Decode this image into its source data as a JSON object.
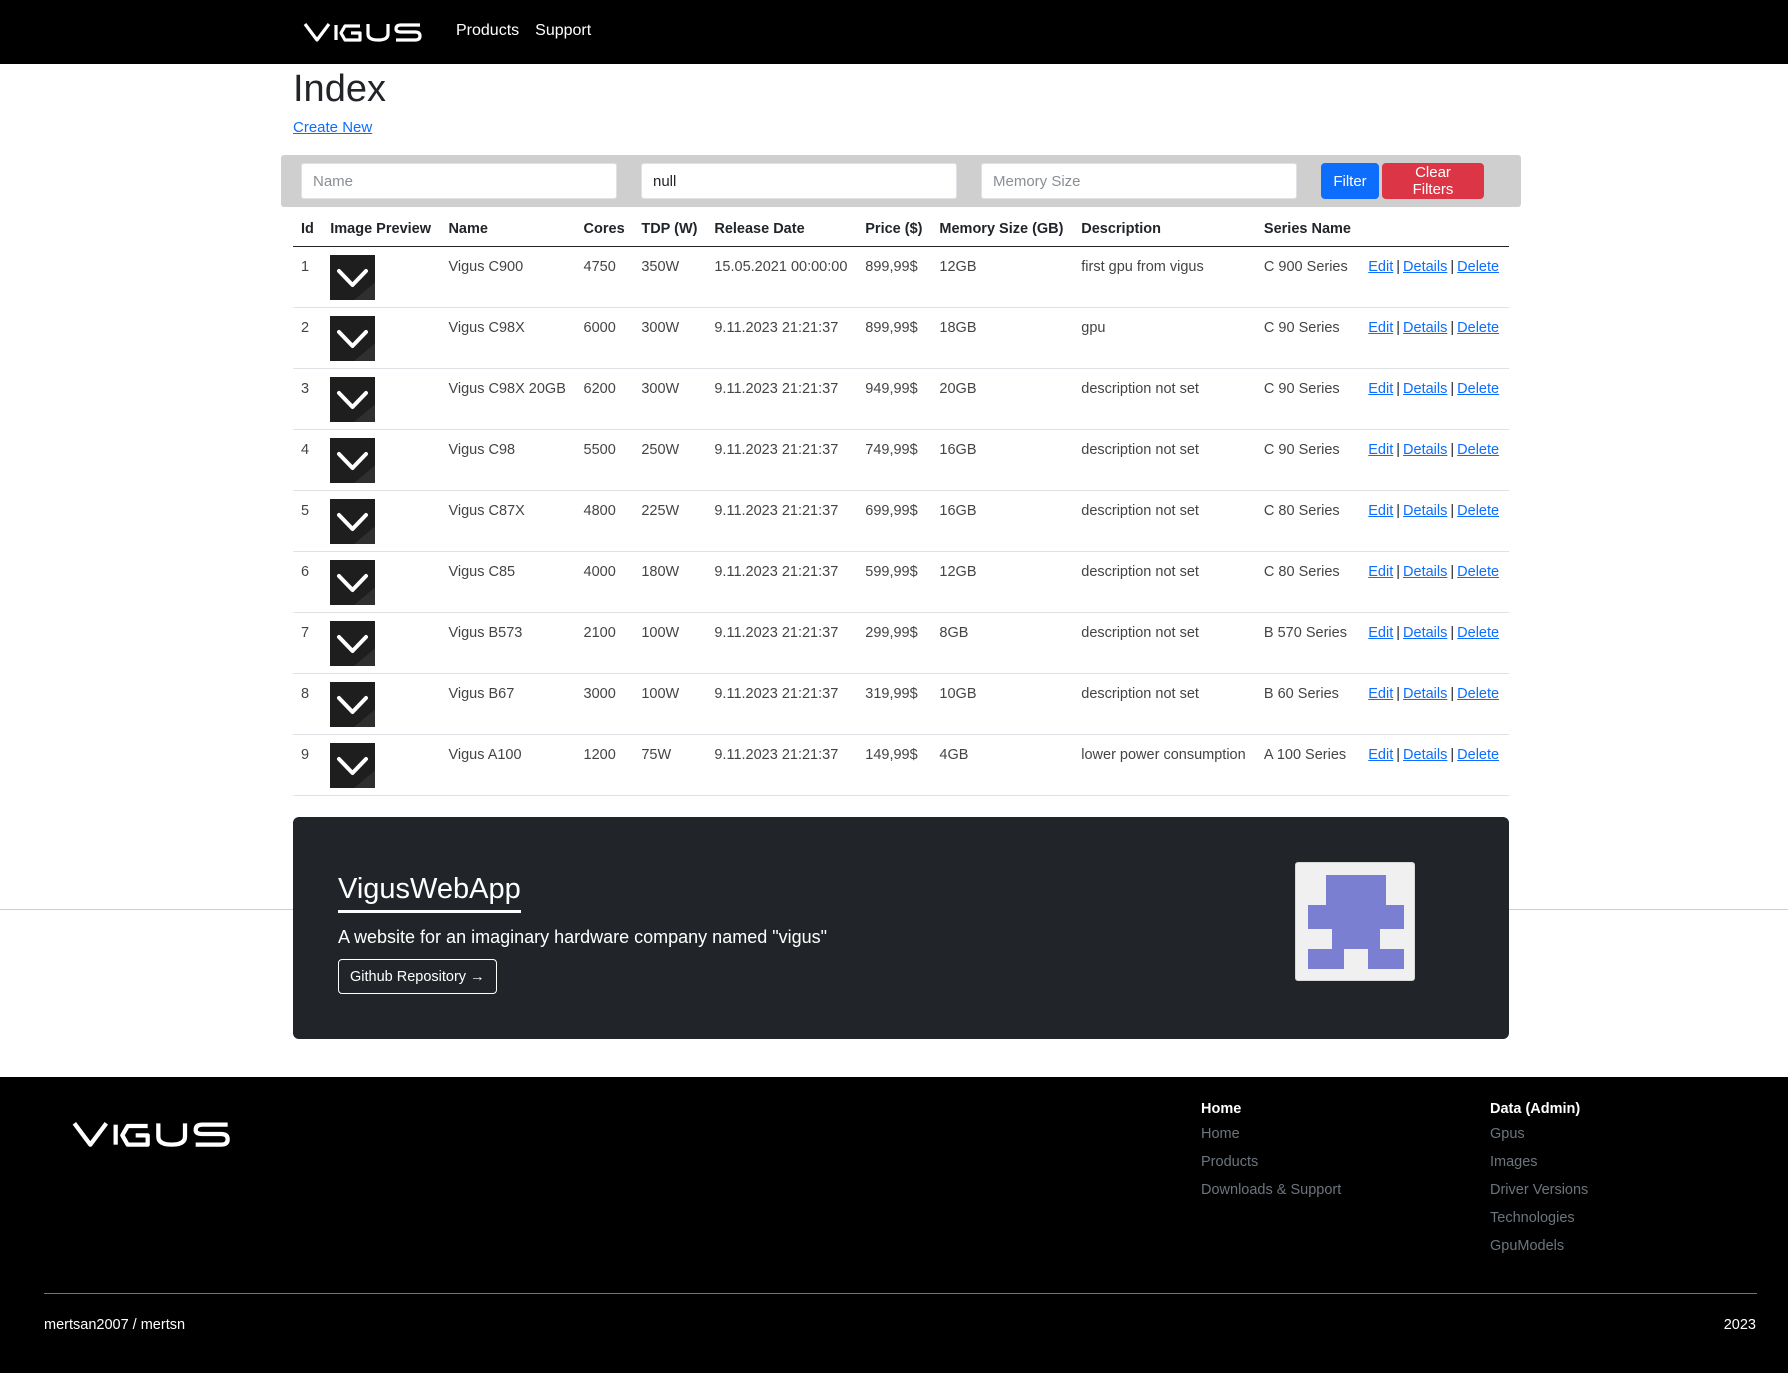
{
  "navbar": {
    "brand": "VIGUS",
    "links": [
      "Products",
      "Support"
    ]
  },
  "page": {
    "title": "Index",
    "create_new": "Create New"
  },
  "filters": {
    "name_placeholder": "Name",
    "series_value": "null",
    "memory_placeholder": "Memory Size",
    "filter_button": "Filter",
    "clear_button": "Clear Filters"
  },
  "table": {
    "headers": [
      "Id",
      "Image Preview",
      "Name",
      "Cores",
      "TDP (W)",
      "Release Date",
      "Price ($)",
      "Memory Size (GB)",
      "Description",
      "Series Name",
      ""
    ],
    "rows": [
      {
        "id": "1",
        "name": "Vigus C900",
        "cores": "4750",
        "tdp": "350W",
        "release": "15.05.2021 00:00:00",
        "price": "899,99$",
        "memory": "12GB",
        "description": "first gpu from vigus",
        "series": "C 900 Series"
      },
      {
        "id": "2",
        "name": "Vigus C98X",
        "cores": "6000",
        "tdp": "300W",
        "release": "9.11.2023 21:21:37",
        "price": "899,99$",
        "memory": "18GB",
        "description": "gpu",
        "series": "C 90 Series"
      },
      {
        "id": "3",
        "name": "Vigus C98X 20GB",
        "cores": "6200",
        "tdp": "300W",
        "release": "9.11.2023 21:21:37",
        "price": "949,99$",
        "memory": "20GB",
        "description": "description not set",
        "series": "C 90 Series"
      },
      {
        "id": "4",
        "name": "Vigus C98",
        "cores": "5500",
        "tdp": "250W",
        "release": "9.11.2023 21:21:37",
        "price": "749,99$",
        "memory": "16GB",
        "description": "description not set",
        "series": "C 90 Series"
      },
      {
        "id": "5",
        "name": "Vigus C87X",
        "cores": "4800",
        "tdp": "225W",
        "release": "9.11.2023 21:21:37",
        "price": "699,99$",
        "memory": "16GB",
        "description": "description not set",
        "series": "C 80 Series"
      },
      {
        "id": "6",
        "name": "Vigus C85",
        "cores": "4000",
        "tdp": "180W",
        "release": "9.11.2023 21:21:37",
        "price": "599,99$",
        "memory": "12GB",
        "description": "description not set",
        "series": "C 80 Series"
      },
      {
        "id": "7",
        "name": "Vigus B573",
        "cores": "2100",
        "tdp": "100W",
        "release": "9.11.2023 21:21:37",
        "price": "299,99$",
        "memory": "8GB",
        "description": "description not set",
        "series": "B 570 Series"
      },
      {
        "id": "8",
        "name": "Vigus B67",
        "cores": "3000",
        "tdp": "100W",
        "release": "9.11.2023 21:21:37",
        "price": "319,99$",
        "memory": "10GB",
        "description": "description not set",
        "series": "B 60 Series"
      },
      {
        "id": "9",
        "name": "Vigus A100",
        "cores": "1200",
        "tdp": "75W",
        "release": "9.11.2023 21:21:37",
        "price": "149,99$",
        "memory": "4GB",
        "description": "lower power consumption",
        "series": "A 100 Series"
      }
    ],
    "actions": {
      "edit": "Edit",
      "details": "Details",
      "delete": "Delete",
      "separator": "|"
    }
  },
  "hero": {
    "title": "VigusWebApp",
    "subtitle": "A website for an imaginary hardware company named \"vigus\"",
    "button": "Github Repository →",
    "avatar_icon": "identicon-avatar",
    "avatar_color": "#7b7fd1"
  },
  "footer": {
    "brand": "VIGUS",
    "col1": {
      "heading": "Home",
      "links": [
        "Home",
        "Products",
        "Downloads & Support"
      ]
    },
    "col2": {
      "heading": "Data (Admin)",
      "links": [
        "Gpus",
        "Images",
        "Driver Versions",
        "Technologies",
        "GpuModels"
      ]
    },
    "left_text": "mertsan2007 / mertsn",
    "right_text": "2023"
  },
  "colors": {
    "primary": "#0d6efd",
    "danger": "#dc3545",
    "dark": "#212529",
    "black": "#000000"
  }
}
